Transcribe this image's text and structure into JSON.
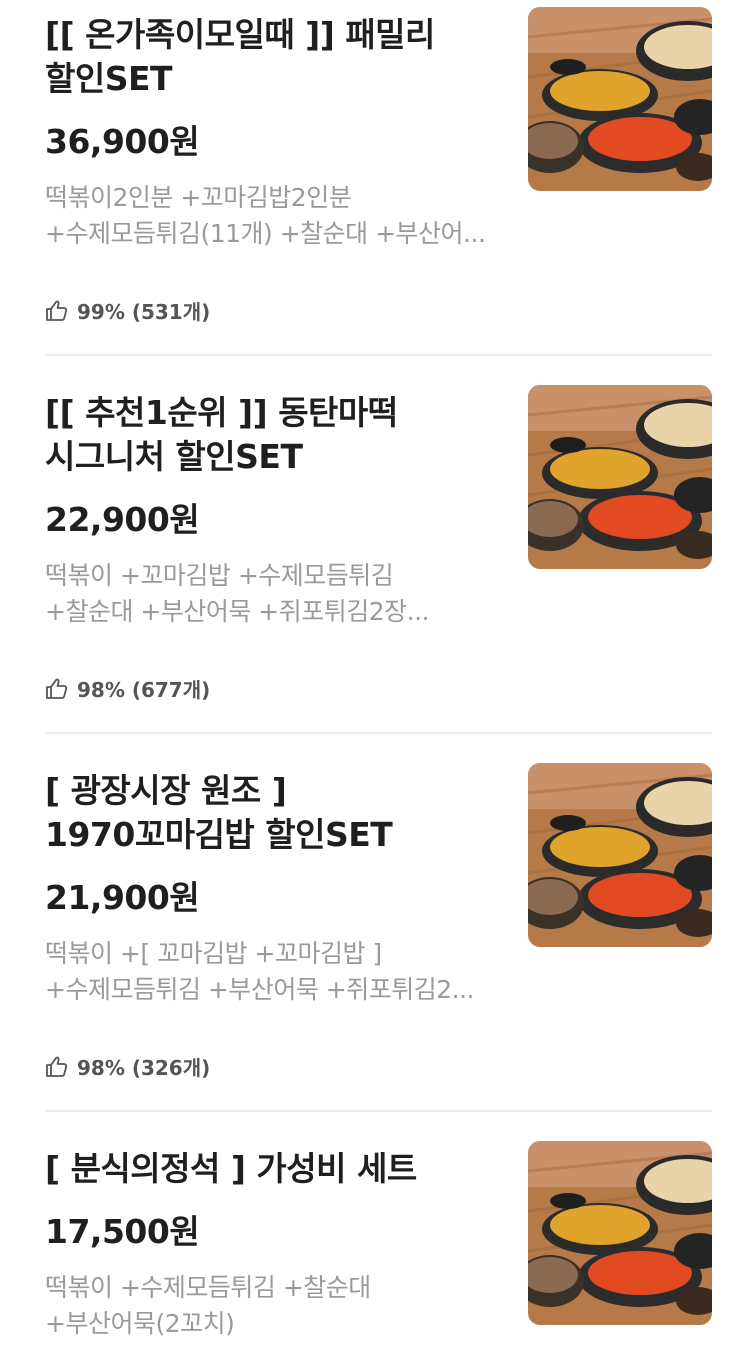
{
  "items": [
    {
      "title_line1": "[[ 온가족이모일때 ]] 패밀리",
      "title_line2": "할인SET",
      "price": "36,900원",
      "desc_line1": "떡볶이2인분 +꼬마김밥2인분",
      "desc_line2": "+수제모듬튀김(11개) +찰순대 +부산어...",
      "rating": "99% (531개)",
      "thumbnail_icon": "food-set-photo"
    },
    {
      "title_line1": "[[ 추천1순위 ]] 동탄마떡",
      "title_line2": "시그니처 할인SET",
      "price": "22,900원",
      "desc_line1": "떡볶이 +꼬마김밥 +수제모듬튀김",
      "desc_line2": "+찰순대 +부산어묵 +쥐포튀김2장...",
      "rating": "98% (677개)",
      "thumbnail_icon": "food-set-photo"
    },
    {
      "title_line1": "[ 광장시장 원조 ]",
      "title_line2": "1970꼬마김밥 할인SET",
      "price": "21,900원",
      "desc_line1": "떡볶이 +[ 꼬마김밥 +꼬마김밥 ]",
      "desc_line2": "+수제모듬튀김 +부산어묵 +쥐포튀김2...",
      "rating": "98% (326개)",
      "thumbnail_icon": "food-set-photo"
    },
    {
      "title_line1": "[ 분식의정석 ] 가성비 세트",
      "price": "17,500원",
      "desc_line1": "떡볶이 +수제모듬튀김 +찰순대",
      "desc_line2": "+부산어묵(2꼬치)",
      "thumbnail_icon": "food-set-photo"
    }
  ],
  "colors": {
    "title": "#1f1f1f",
    "description": "#9a9a9a",
    "rating": "#555555",
    "divider": "#ececec"
  }
}
